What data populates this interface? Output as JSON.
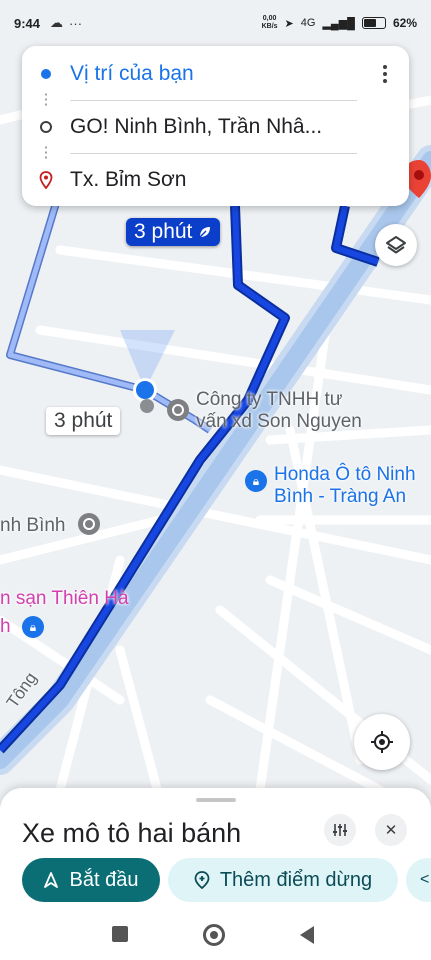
{
  "status_bar": {
    "time": "9:44",
    "network_speed_value": "0,00",
    "network_speed_unit": "KB/s",
    "network_type": "4G",
    "battery_percent": "62%",
    "icons": [
      "cloud-icon",
      "more-dots-icon",
      "location-arrow-icon",
      "signal-icon",
      "battery-icon"
    ]
  },
  "route": {
    "origin": "Vị trí của bạn",
    "stop": "GO! Ninh Bình, Trần Nhâ...",
    "destination": "Tx. Bỉm Sơn"
  },
  "map": {
    "primary_route_time": "3 phút",
    "alt_route_time": "3 phút",
    "street_label": "Tông",
    "places": {
      "company": "Công ty TNHH tư vấn xd Son Nguyen",
      "company_line1": "Công ty TNHH tư",
      "company_line2": "vấn xd Son Nguyen",
      "honda_line1": "Honda Ô tô Ninh",
      "honda_line2": "Bình - Tràng An",
      "ninh_binh": "nh Bình",
      "hotel": "n sạn Thiên Hà",
      "hotel_2": "h"
    }
  },
  "bottom_sheet": {
    "mode": "Xe mô tô hai bánh",
    "start_label": "Bắt đầu",
    "add_stop_label": "Thêm điểm dừng"
  },
  "colors": {
    "route_primary": "#0b3ec9",
    "route_alt": "#7ea4f5",
    "road_main": "#a9c7ec",
    "start_button": "#0b6e75",
    "chip_bg": "#dff4f7",
    "accent_blue": "#1a73e8",
    "hotel_pink": "#d33fae"
  }
}
